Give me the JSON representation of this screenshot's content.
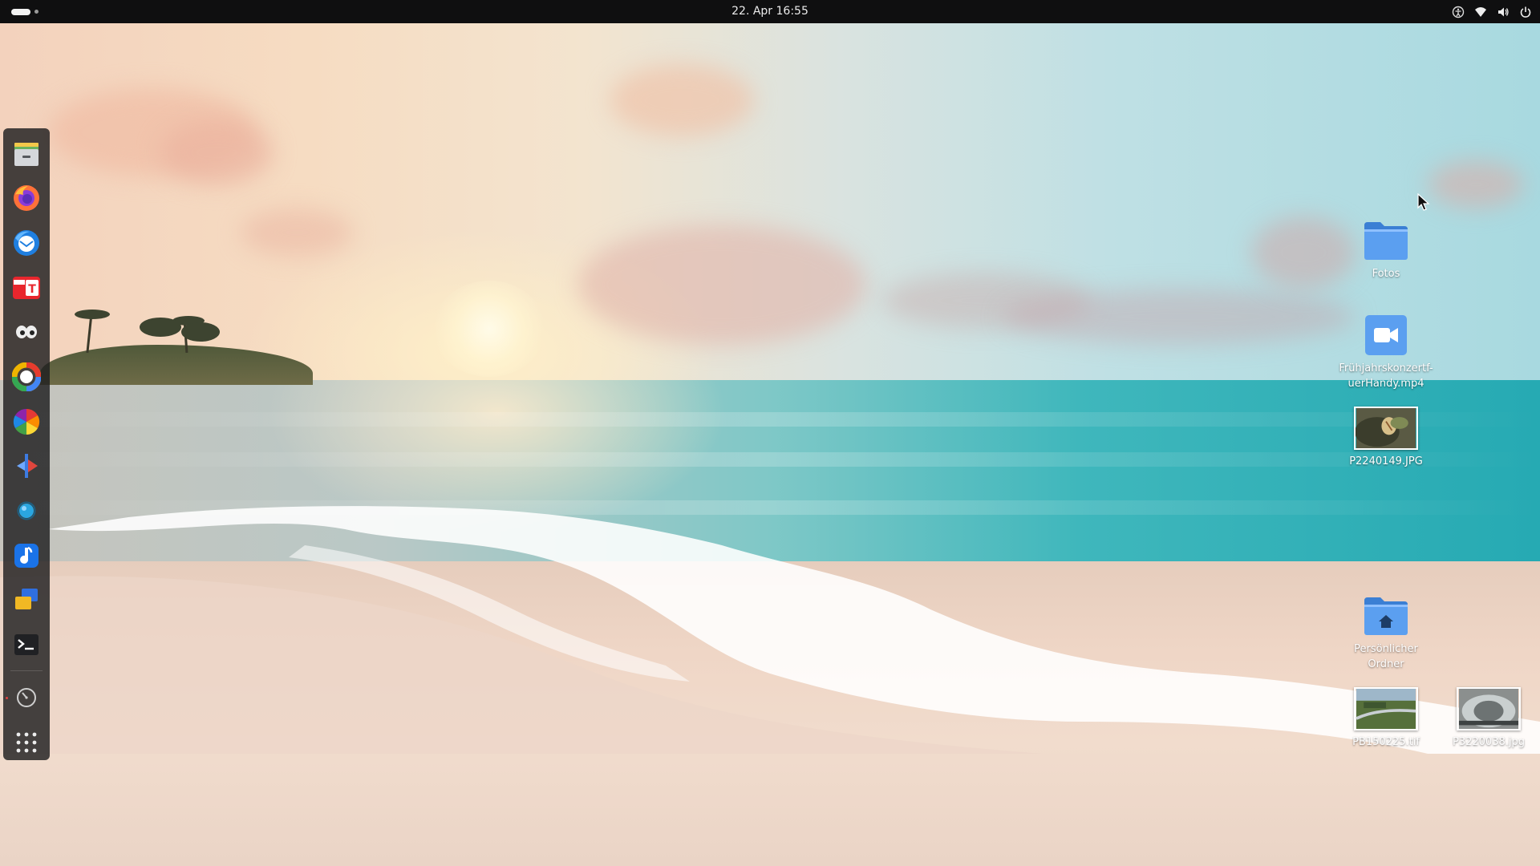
{
  "topbar": {
    "datetime": "22. Apr  16:55",
    "tray": {
      "icons": [
        "accessibility-icon",
        "wifi-icon",
        "volume-icon",
        "power-icon"
      ]
    }
  },
  "dock": {
    "apps": [
      {
        "name": "files",
        "icon": "file-cabinet-icon"
      },
      {
        "name": "firefox",
        "icon": "firefox-icon"
      },
      {
        "name": "thunderbird",
        "icon": "thunderbird-icon"
      },
      {
        "name": "free-text",
        "icon": "free-t-icon"
      },
      {
        "name": "eyes",
        "icon": "eyes-icon"
      },
      {
        "name": "color-ring",
        "icon": "color-ring-icon"
      },
      {
        "name": "pinwheel",
        "icon": "pinwheel-icon"
      },
      {
        "name": "arrow-tool",
        "icon": "arrow-tool-icon"
      },
      {
        "name": "orb",
        "icon": "orb-icon"
      },
      {
        "name": "music-note",
        "icon": "music-note-icon"
      },
      {
        "name": "windows",
        "icon": "windows-icon"
      },
      {
        "name": "terminal",
        "icon": "terminal-icon"
      },
      {
        "name": "clock",
        "icon": "clock-icon"
      },
      {
        "name": "app-grid",
        "icon": "app-grid-icon"
      }
    ]
  },
  "desktop": {
    "items": [
      {
        "label": "Fotos",
        "type": "folder"
      },
      {
        "label": "Frühjahrskonzertf-uerHandy.mp4",
        "type": "video"
      },
      {
        "label": "P2240149.JPG",
        "type": "image"
      },
      {
        "label": "Persönlicher Ordner",
        "type": "home-folder"
      },
      {
        "label": "PB150225.tif",
        "type": "image"
      },
      {
        "label": "P3220038.jpg",
        "type": "image"
      }
    ]
  },
  "colors": {
    "topbar": "#0f0f10",
    "folder_blue": "#4a90e2",
    "dock_bg": "#1e1e20"
  }
}
